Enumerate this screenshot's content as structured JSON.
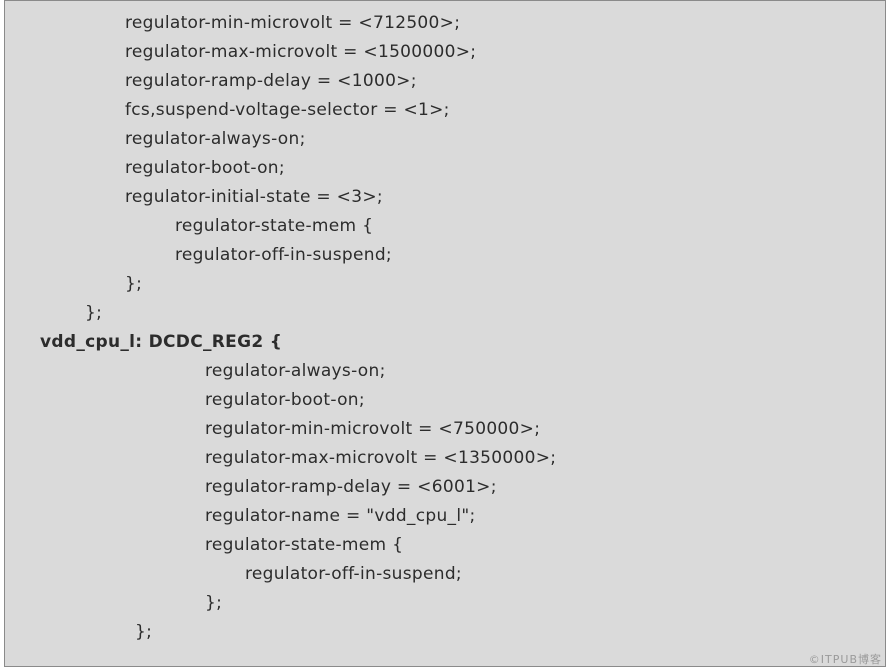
{
  "code": {
    "l1": "regulator-min-microvolt = <712500>;",
    "l2": "regulator-max-microvolt = <1500000>;",
    "l3": "regulator-ramp-delay = <1000>;",
    "l4": "fcs,suspend-voltage-selector = <1>;",
    "l5": "regulator-always-on;",
    "l6": "regulator-boot-on;",
    "l7": "regulator-initial-state = <3>;",
    "l8": "regulator-state-mem {",
    "l9": "regulator-off-in-suspend;",
    "l10": "};",
    "l11": "};",
    "l12": "vdd_cpu_l: DCDC_REG2 {",
    "l13": "regulator-always-on;",
    "l14": "regulator-boot-on;",
    "l15": "regulator-min-microvolt = <750000>;",
    "l16": "regulator-max-microvolt = <1350000>;",
    "l17": "regulator-ramp-delay = <6001>;",
    "l18": "regulator-name = \"vdd_cpu_l\";",
    "l19": "regulator-state-mem {",
    "l20": "regulator-off-in-suspend;",
    "l21": "};",
    "l22": "};"
  },
  "watermark": "©ITPUB博客"
}
